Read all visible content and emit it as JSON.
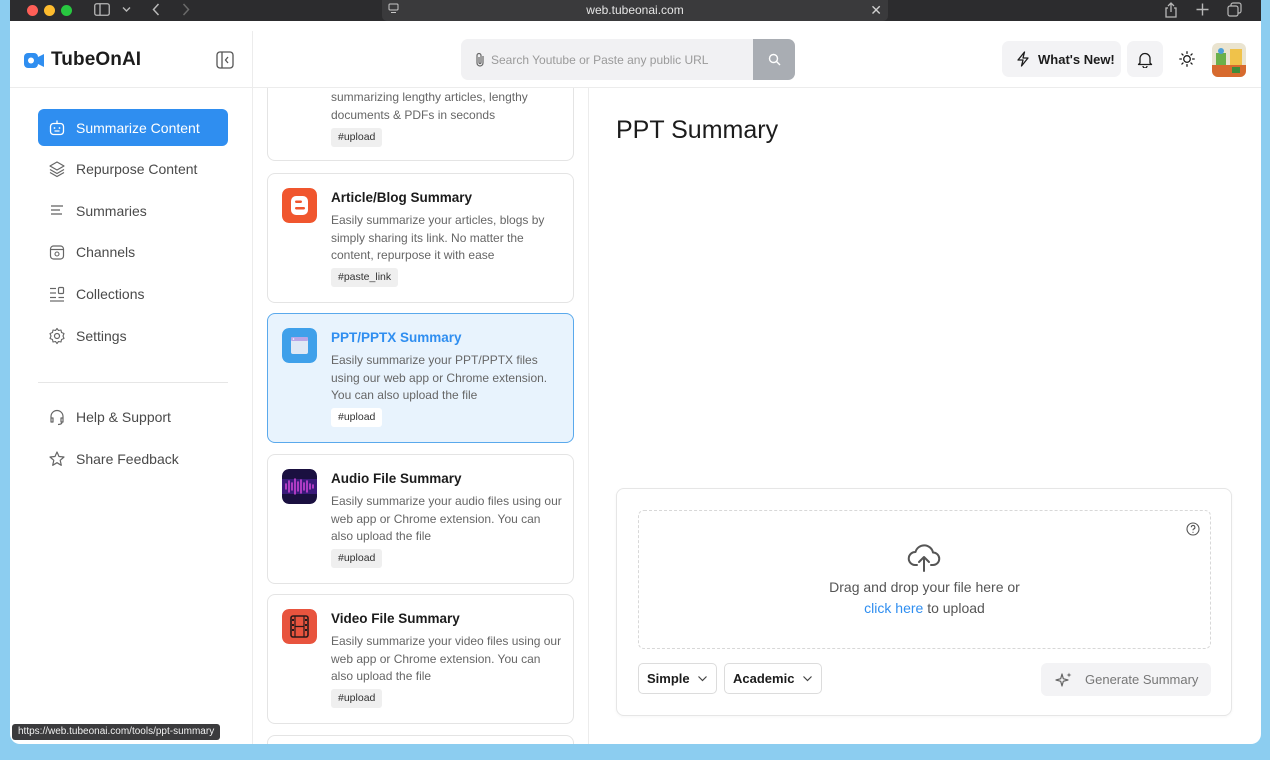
{
  "browser": {
    "url": "web.tubeonai.com",
    "status_url": "https://web.tubeonai.com/tools/ppt-summary"
  },
  "header": {
    "brand": "TubeOnAI",
    "search_placeholder": "Search Youtube or Paste any public URL",
    "whats_new": "What's New!"
  },
  "sidebar": {
    "items": [
      {
        "label": "Summarize Content",
        "icon": "robot-icon",
        "active": true
      },
      {
        "label": "Repurpose Content",
        "icon": "layers-icon"
      },
      {
        "label": "Summaries",
        "icon": "lines-icon"
      },
      {
        "label": "Channels",
        "icon": "channel-icon"
      },
      {
        "label": "Collections",
        "icon": "collections-icon"
      },
      {
        "label": "Settings",
        "icon": "gear-icon"
      }
    ],
    "bottom": [
      {
        "label": "Help & Support",
        "icon": "headset-icon"
      },
      {
        "label": "Share Feedback",
        "icon": "star-icon"
      }
    ]
  },
  "tools": [
    {
      "title": "",
      "desc": "summarizing lengthy articles, lengthy documents & PDFs in seconds",
      "tag": "#upload"
    },
    {
      "title": "Article/Blog Summary",
      "desc": "Easily summarize your articles, blogs by simply sharing its link. No matter the content, repurpose it with ease",
      "tag": "#paste_link"
    },
    {
      "title": "PPT/PPTX Summary",
      "desc": "Easily summarize your PPT/PPTX files using our web app or Chrome extension. You can also upload the file",
      "tag": "#upload"
    },
    {
      "title": "Audio File Summary",
      "desc": "Easily summarize your audio files using our web app or Chrome extension. You can also upload the file",
      "tag": "#upload"
    },
    {
      "title": "Video File Summary",
      "desc": "Easily summarize your video files using our web app or Chrome extension. You can also upload the file",
      "tag": "#upload"
    }
  ],
  "main": {
    "title": "PPT Summary",
    "drop_text": "Drag and drop your file here or",
    "click_here": "click here",
    "to_upload": " to upload",
    "mode_select": "Simple",
    "style_select": "Academic",
    "generate": "Generate Summary"
  },
  "colors": {
    "accent": "#2f8ef0",
    "selected_card_bg": "#e8f3fd"
  }
}
